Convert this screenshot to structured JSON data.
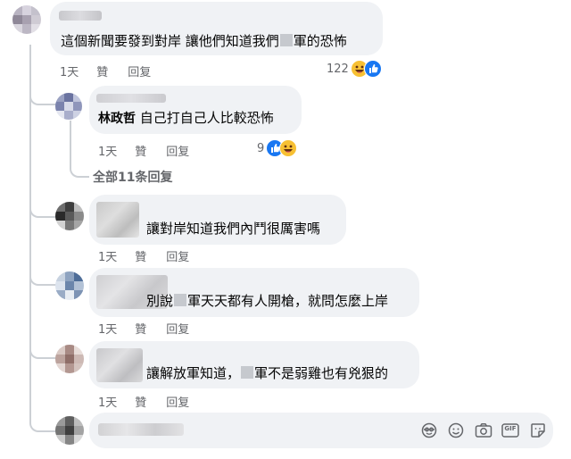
{
  "comments": [
    {
      "text_before": "這個新聞要發到對岸 讓他們知道我們",
      "text_after": "軍的恐怖",
      "actions": {
        "age": "1天",
        "like": "贊",
        "reply": "回复"
      },
      "reactions": {
        "count": "122",
        "icons": [
          "laugh",
          "like"
        ]
      }
    },
    {
      "author": "林政哲",
      "text": "自己打自己人比較恐怖",
      "actions": {
        "age": "1天",
        "like": "贊",
        "reply": "回复"
      },
      "reactions": {
        "count": "9",
        "icons": [
          "like",
          "laugh"
        ]
      }
    },
    {
      "text": "讓對岸知道我們內鬥很厲害嗎",
      "actions": {
        "age": "1天",
        "like": "贊",
        "reply": "回复"
      }
    },
    {
      "text_before": "別說",
      "text_after": "軍天天都有人開槍，就問怎麼上岸",
      "actions": {
        "age": "1天",
        "like": "贊",
        "reply": "回复"
      }
    },
    {
      "text_before": "讓解放軍知道，",
      "text_after": "軍不是弱雞也有兇狠的",
      "actions": {
        "age": "1天",
        "like": "贊",
        "reply": "回复"
      }
    }
  ],
  "view_more_replies": "全部11条回复",
  "composer": {
    "icons": [
      "sticker-face-icon",
      "emoji-icon",
      "camera-icon",
      "gif-icon",
      "sticker-icon"
    ],
    "gif_label": "GIF"
  },
  "colors": {
    "bubble": "#f0f2f5",
    "secondary_text": "#65676b",
    "like_blue": "#1877f2",
    "laugh_yellow": "#f7c033",
    "thread_line": "#ccd0d5"
  }
}
